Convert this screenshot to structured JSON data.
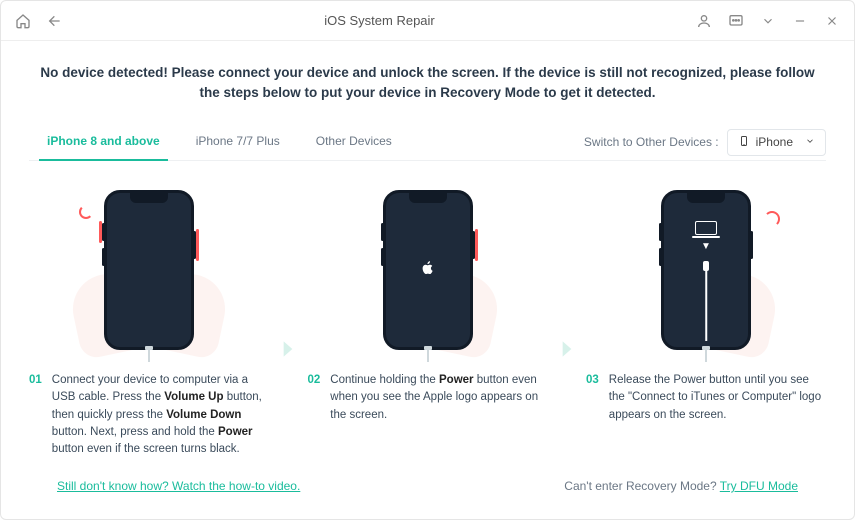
{
  "titlebar": {
    "title": "iOS System Repair"
  },
  "alert": "No device detected! Please connect your device and unlock the screen. If the device is still not recognized, please follow the steps below to put your device in Recovery Mode to get it detected.",
  "tabs": [
    {
      "label": "iPhone 8 and above",
      "active": true
    },
    {
      "label": "iPhone 7/7 Plus",
      "active": false
    },
    {
      "label": "Other Devices",
      "active": false
    }
  ],
  "switch": {
    "label": "Switch to Other Devices :",
    "selected": "iPhone"
  },
  "steps": [
    {
      "num": "01",
      "text_pre": "Connect your device to computer via a USB cable. Press the ",
      "b1": "Volume Up",
      "mid1": " button, then quickly press the ",
      "b2": "Volume Down",
      "mid2": " button. Next, press and hold the ",
      "b3": "Power",
      "post": " button even if the screen turns black."
    },
    {
      "num": "02",
      "text_pre": "Continue holding the ",
      "b1": "Power",
      "post": " button even when you see the Apple logo appears on the screen."
    },
    {
      "num": "03",
      "text_pre": "Release the Power button until you see the \"Connect to iTunes or Computer\" logo appears on the screen.",
      "b1": "",
      "post": ""
    }
  ],
  "footer": {
    "left_link": "Still don't know how? Watch the how-to video.",
    "right_text": "Can't enter Recovery Mode? ",
    "right_link": "Try DFU Mode"
  }
}
